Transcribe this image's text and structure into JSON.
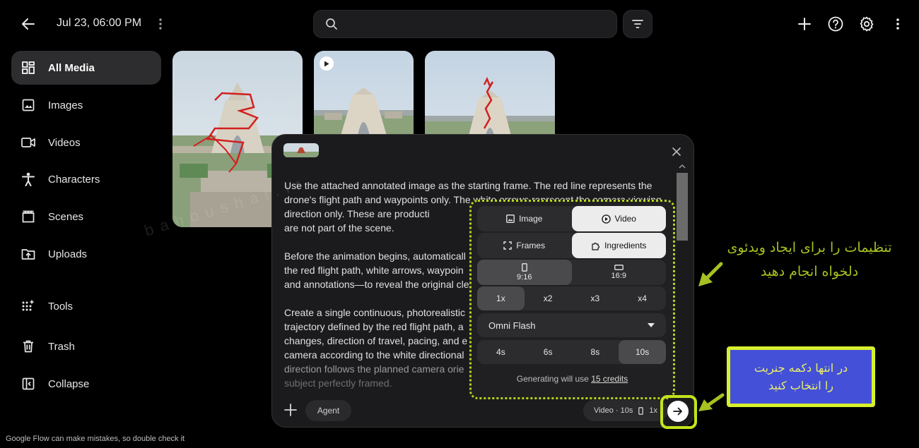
{
  "header": {
    "date": "Jul 23, 06:00 PM"
  },
  "sidebar": {
    "items": [
      {
        "label": "All Media"
      },
      {
        "label": "Images"
      },
      {
        "label": "Videos"
      },
      {
        "label": "Characters"
      },
      {
        "label": "Scenes"
      },
      {
        "label": "Uploads"
      },
      {
        "label": "Tools"
      },
      {
        "label": "Trash"
      },
      {
        "label": "Collapse"
      }
    ]
  },
  "prompt": {
    "paragraphs": [
      "Use the attached annotated image as the starting frame. The red line represents the drone's flight path and waypoints only. The white arrows represent the camera viewing direction only. These are producti",
      "are not part of the scene.",
      "Before the animation begins, automaticall",
      "the red flight path, white arrows, waypoin",
      "and annotations—to reveal the original cle",
      "Create a single continuous, photorealistic",
      "trajectory defined by the red flight path, a",
      "changes, direction of travel, pacing, and e",
      "camera according to the white directional",
      "direction follows the planned camera orie",
      "subject perfectly framed."
    ],
    "agent_label": "Agent",
    "summary": {
      "text": "Video · 10s",
      "count": "1x"
    }
  },
  "settings": {
    "mode": [
      "Image",
      "Video"
    ],
    "type": [
      "Frames",
      "Ingredients"
    ],
    "ratio": [
      "9:16",
      "16:9"
    ],
    "count": [
      "1x",
      "x2",
      "x3",
      "x4"
    ],
    "model": "Omni Flash",
    "duration": [
      "4s",
      "6s",
      "8s",
      "10s"
    ],
    "credits_prefix": "Generating will use",
    "credits_link": "15 credits"
  },
  "annotations": {
    "note1_line1": "تنظیمات را برای ایجاد ویدئوی",
    "note1_line2": "دلخواه انجام دهید",
    "note2_line1": "در انتها دکمه جنریت",
    "note2_line2": "را انتخاب کنید",
    "watermark": "bahoushai.ir"
  },
  "footer": {
    "text": "Google Flow can make mistakes, so double check it"
  },
  "colors": {
    "accent": "#b5d51a",
    "note_blue": "#4450d8",
    "panel": "#1b1b1d"
  }
}
